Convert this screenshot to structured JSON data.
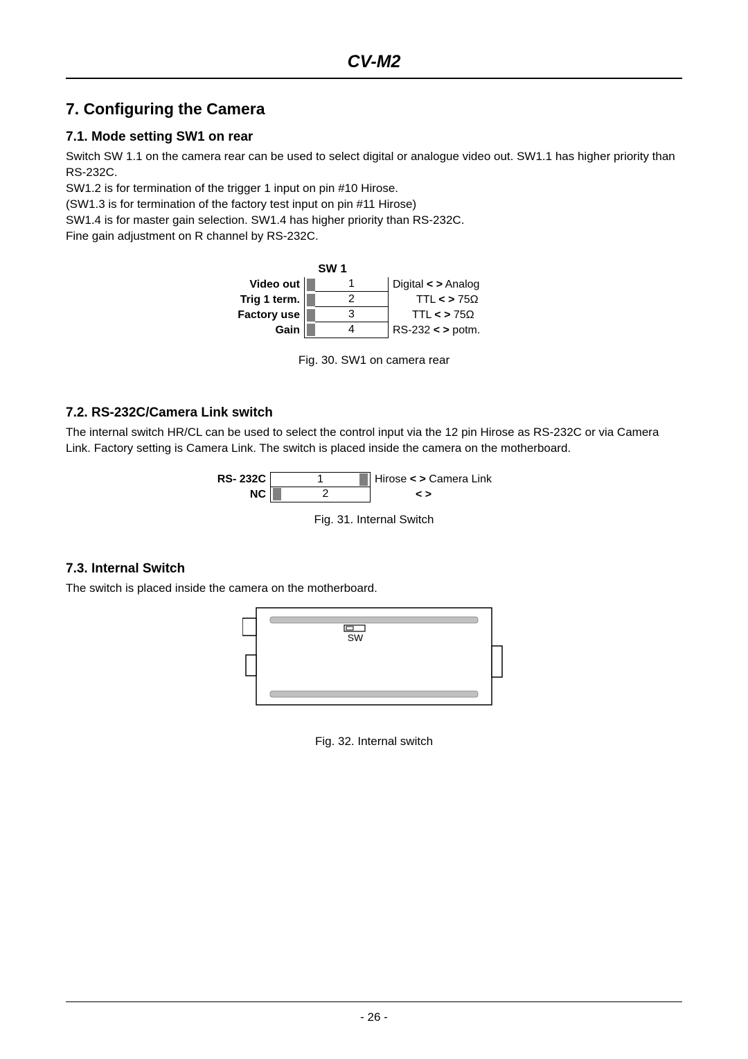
{
  "header": {
    "title": "CV-M2"
  },
  "section7": {
    "heading": "7. Configuring the Camera"
  },
  "section71": {
    "heading": "7.1. Mode setting SW1 on rear",
    "line1": "Switch SW 1.1 on the camera rear can be used to select digital or analogue video out.  SW1.1 has higher priority than RS-232C.",
    "line2": "SW1.2 is for termination of the trigger 1 input on pin #10 Hirose.",
    "line3": "(SW1.3 is for termination of the factory test input on pin #11 Hirose)",
    "line4": "SW1.4 is for master gain selection. SW1.4 has higher priority than RS-232C.",
    "line5": "Fine gain adjustment on R channel by RS-232C."
  },
  "sw1": {
    "title": "SW 1",
    "rows": [
      {
        "left": "Video out",
        "num": "1",
        "rprefix": "Digital ",
        "rsuffix": " Analog"
      },
      {
        "left": "Trig 1 term.",
        "num": "2",
        "rprefix": "TTL ",
        "rsuffix": " 75Ω"
      },
      {
        "left": "Factory use",
        "num": "3",
        "rprefix": "TTL ",
        "rsuffix": " 75Ω"
      },
      {
        "left": "Gain",
        "num": "4",
        "rprefix": "RS-232 ",
        "rsuffix": " potm."
      }
    ]
  },
  "fig30": "Fig. 30. SW1 on camera rear",
  "section72": {
    "heading": "7.2. RS-232C/Camera Link switch",
    "text": "The internal switch HR/CL can be used to select the control input via the 12 pin Hirose as RS-232C or via Camera Link. Factory setting is Camera Link. The switch is placed inside the camera on the motherboard."
  },
  "rs232": {
    "rows": [
      {
        "left": "RS- 232C",
        "num": "1",
        "rprefix": "Hirose ",
        "rsuffix": " Camera Link"
      },
      {
        "left": "NC",
        "num": "2",
        "rprefix": " ",
        "rsuffix": "  "
      }
    ]
  },
  "fig31": "Fig. 31. Internal Switch",
  "section73": {
    "heading": "7.3. Internal Switch",
    "text": "The switch is placed inside the camera on the motherboard."
  },
  "mb": {
    "sw_label": "SW"
  },
  "fig32": "Fig. 32. Internal switch",
  "footer": {
    "page": "- 26 -"
  },
  "symbols": {
    "lt_gt": "<  >"
  }
}
